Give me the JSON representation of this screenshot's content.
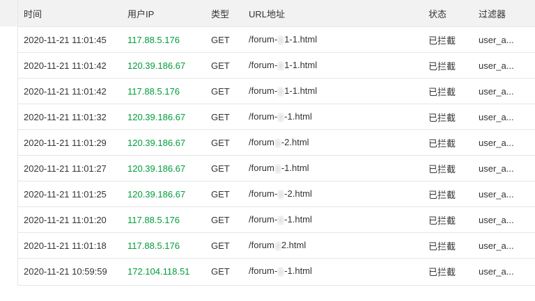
{
  "table": {
    "columns": [
      "时间",
      "用户IP",
      "类型",
      "URL地址",
      "状态",
      "过滤器"
    ],
    "rows": [
      {
        "time": "2020-11-21 11:01:45",
        "ip": "117.88.5.176",
        "method": "GET",
        "url_a": "/forum-",
        "url_b": "1-1.html",
        "status": "已拦截",
        "filter": "user_a..."
      },
      {
        "time": "2020-11-21 11:01:42",
        "ip": "120.39.186.67",
        "method": "GET",
        "url_a": "/forum-",
        "url_b": "1-1.html",
        "status": "已拦截",
        "filter": "user_a..."
      },
      {
        "time": "2020-11-21 11:01:42",
        "ip": "117.88.5.176",
        "method": "GET",
        "url_a": "/forum-",
        "url_b": "1-1.html",
        "status": "已拦截",
        "filter": "user_a..."
      },
      {
        "time": "2020-11-21 11:01:32",
        "ip": "120.39.186.67",
        "method": "GET",
        "url_a": "/forum-",
        "url_b": "-1.html",
        "status": "已拦截",
        "filter": "user_a..."
      },
      {
        "time": "2020-11-21 11:01:29",
        "ip": "120.39.186.67",
        "method": "GET",
        "url_a": "/forum",
        "url_b": "-2.html",
        "status": "已拦截",
        "filter": "user_a..."
      },
      {
        "time": "2020-11-21 11:01:27",
        "ip": "120.39.186.67",
        "method": "GET",
        "url_a": "/forum",
        "url_b": "-1.html",
        "status": "已拦截",
        "filter": "user_a..."
      },
      {
        "time": "2020-11-21 11:01:25",
        "ip": "120.39.186.67",
        "method": "GET",
        "url_a": "/forum-",
        "url_b": "-2.html",
        "status": "已拦截",
        "filter": "user_a..."
      },
      {
        "time": "2020-11-21 11:01:20",
        "ip": "117.88.5.176",
        "method": "GET",
        "url_a": "/forum-",
        "url_b": "-1.html",
        "status": "已拦截",
        "filter": "user_a..."
      },
      {
        "time": "2020-11-21 11:01:18",
        "ip": "117.88.5.176",
        "method": "GET",
        "url_a": "/forum",
        "url_b": "2.html",
        "status": "已拦截",
        "filter": "user_a..."
      },
      {
        "time": "2020-11-21 10:59:59",
        "ip": "172.104.118.51",
        "method": "GET",
        "url_a": "/forum-",
        "url_b": "-1.html",
        "status": "已拦截",
        "filter": "user_a..."
      }
    ]
  }
}
